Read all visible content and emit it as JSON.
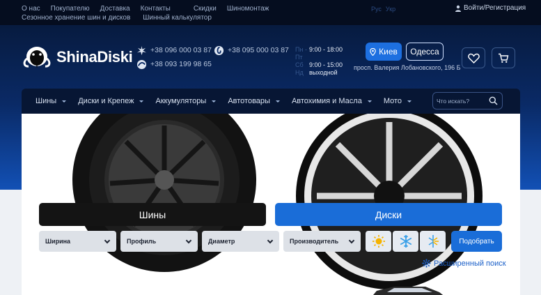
{
  "topbar": {
    "links_row1": [
      "О нас",
      "Покупателю",
      "Доставка",
      "Контакты",
      "Скидки",
      "Шиномонтаж"
    ],
    "links_row2": [
      "Сезонное хранение шин и дисков",
      "Шинный калькулятор"
    ],
    "lang_ru": "Рус",
    "lang_ua": "Укр",
    "login": "Войти/Регистрация"
  },
  "header": {
    "logo_text": "ShinaDiski",
    "phone_kyivstar": "+38 096 000 03 87",
    "phone_vodafone": "+38 095 000 03 87",
    "phone_lifecell": "+38 093 199 98 65",
    "hours": [
      {
        "days": "Пн - Пт",
        "time": "9:00 - 18:00"
      },
      {
        "days": "Сб",
        "time": "9:00 - 15:00"
      },
      {
        "days": "Нд",
        "time": "выходной"
      }
    ],
    "city_kiev": "Киев",
    "city_odessa": "Одесса",
    "address": "просп. Валерия Лобановского, 196 Б"
  },
  "nav": {
    "items": [
      "Шины",
      "Диски и Крепеж",
      "Аккумуляторы",
      "Автотовары",
      "Автохимия и Масла",
      "Мото"
    ],
    "search_placeholder": "Что искать?"
  },
  "finder": {
    "tab_tires": "Шины",
    "tab_disks": "Диски",
    "selects": [
      "Ширина",
      "Профиль",
      "Диаметр",
      "Производитель"
    ],
    "submit": "Подобрать",
    "advanced": "Расширенный поиск"
  },
  "icons": [
    "user-icon",
    "kyivstar-icon",
    "vodafone-icon",
    "lifecell-icon",
    "location-pin-icon",
    "heart-icon",
    "cart-icon",
    "search-icon",
    "sun-icon",
    "snowflake-icon",
    "all-season-icon",
    "settings-gear-icon"
  ],
  "colors": {
    "accent": "#1a6dd8",
    "dark": "#071634",
    "tab_dark": "#141414"
  }
}
